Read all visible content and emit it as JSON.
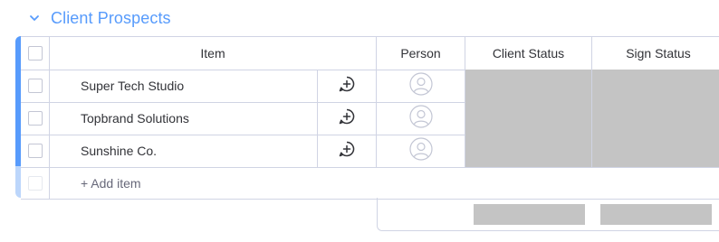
{
  "group": {
    "title": "Client Prospects",
    "color": "#579bfc"
  },
  "columns": {
    "item": "Item",
    "person": "Person",
    "client_status": "Client Status",
    "sign_status": "Sign Status"
  },
  "rows": [
    {
      "name": "Super Tech Studio"
    },
    {
      "name": "Topbrand Solutions"
    },
    {
      "name": "Sunshine Co."
    }
  ],
  "add_item_label": "+ Add item",
  "icons": {
    "collapse": "chevron-down-icon",
    "conversation": "add-update-icon",
    "person": "person-avatar-icon"
  },
  "colors": {
    "status_empty": "#c4c4c4",
    "grid": "#d0d4e4",
    "accent_light": "#bcd6fb"
  }
}
